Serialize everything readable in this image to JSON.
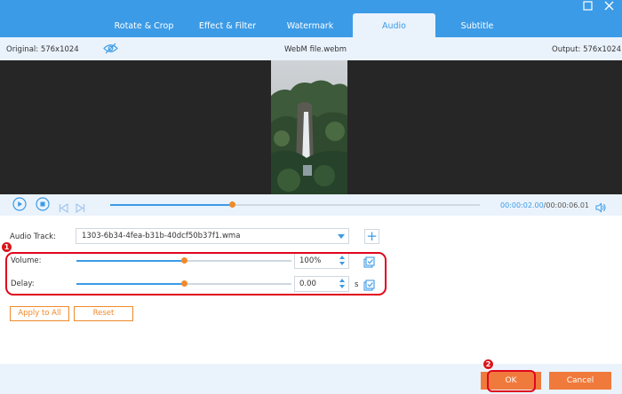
{
  "tabs": [
    {
      "label": "Rotate & Crop"
    },
    {
      "label": "Effect & Filter"
    },
    {
      "label": "Watermark"
    },
    {
      "label": "Audio"
    },
    {
      "label": "Subtitle"
    }
  ],
  "active_tab": "Audio",
  "window": {
    "maximize_icon": "maximize-icon",
    "close_icon": "close-icon"
  },
  "info": {
    "original": "Original: 576x1024",
    "filename": "WebM file.webm",
    "output": "Output: 576x1024"
  },
  "playback": {
    "current_time": "00:00:02.00",
    "total_time": "/00:00:06.01",
    "progress_fraction": 0.33
  },
  "audio": {
    "track_label": "Audio Track:",
    "track_value": "1303-6b34-4fea-b31b-40dcf50b37f1.wma",
    "volume_label": "Volume:",
    "volume_value": "100%",
    "volume_fraction": 0.5,
    "delay_label": "Delay:",
    "delay_value": "0.00",
    "delay_unit": "s",
    "delay_fraction": 0.5
  },
  "buttons": {
    "apply_all": "Apply to All",
    "reset": "Reset",
    "ok": "OK",
    "cancel": "Cancel"
  },
  "annotations": {
    "badge1": "1",
    "badge2": "2"
  },
  "colors": {
    "accent": "#3c9be6",
    "orange": "#f08a2a",
    "highlight": "#e0061b"
  }
}
